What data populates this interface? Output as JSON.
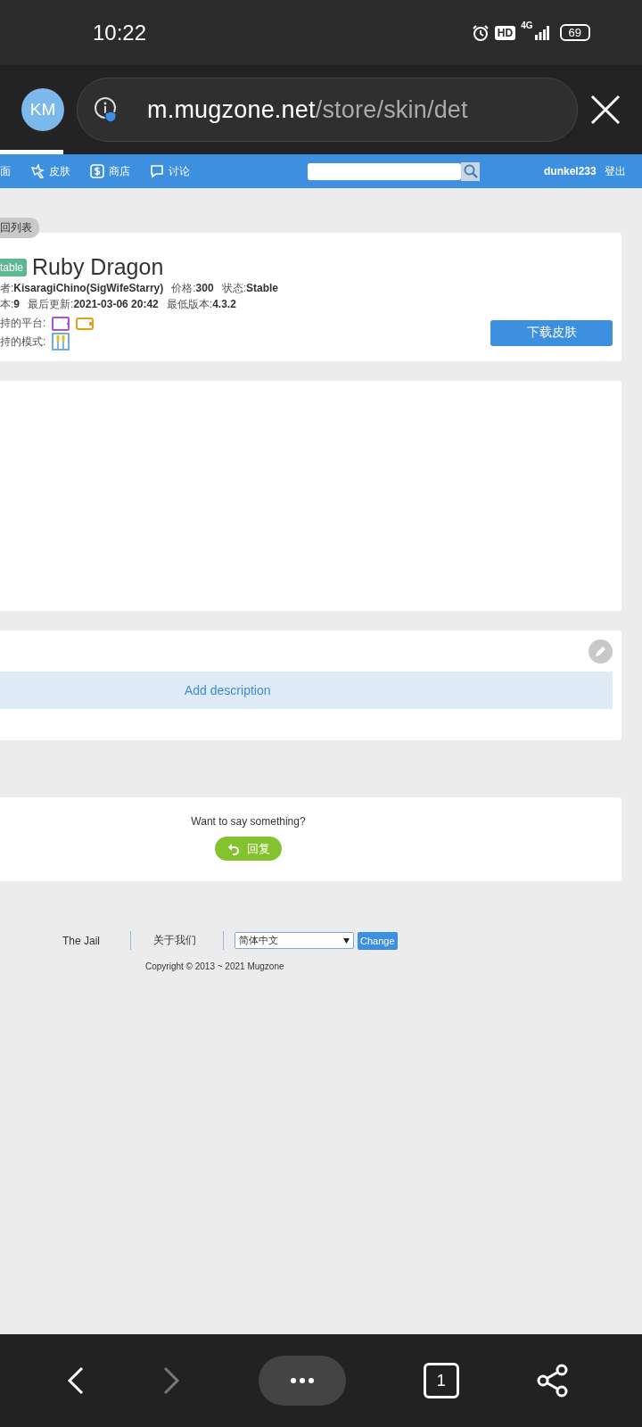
{
  "status_bar": {
    "time": "10:22",
    "hd": "HD",
    "network": "4G",
    "battery": "69"
  },
  "browser": {
    "avatar": "KM",
    "url_host": "m.mugzone.net",
    "url_path": "/store/skin/det"
  },
  "nav": {
    "items": [
      {
        "label": "面"
      },
      {
        "label": "皮肤"
      },
      {
        "label": "商店"
      },
      {
        "label": "讨论"
      }
    ],
    "user": "dunkel233",
    "logout": "登出"
  },
  "back_link": "回列表",
  "skin": {
    "badge": "table",
    "title": "Ruby Dragon",
    "meta_rows": [
      [
        {
          "label": "者:",
          "value": "KisaragiChino(SigWifeStarry)"
        },
        {
          "label": "价格:",
          "value": "300"
        },
        {
          "label": "状态:",
          "value": "Stable"
        }
      ],
      [
        {
          "label": "本:",
          "value": "9"
        },
        {
          "label": "最后更新:",
          "value": "2021-03-06 20:42"
        },
        {
          "label": "最低版本:",
          "value": "4.3.2"
        }
      ]
    ],
    "platforms_label": "持的平台:",
    "modes_label": "持的模式:",
    "download": "下载皮肤"
  },
  "description": {
    "add": "Add description"
  },
  "comments": {
    "prompt": "Want to say something?",
    "reply": "回复"
  },
  "footer": {
    "links": [
      "The Jail",
      "关于我们"
    ],
    "language": "简体中文",
    "change": "Change",
    "copyright": "Copyright © 2013 ~ 2021 Mugzone"
  },
  "bottom_bar": {
    "back_disabled": false,
    "forward_disabled": true,
    "tabs": "1"
  }
}
